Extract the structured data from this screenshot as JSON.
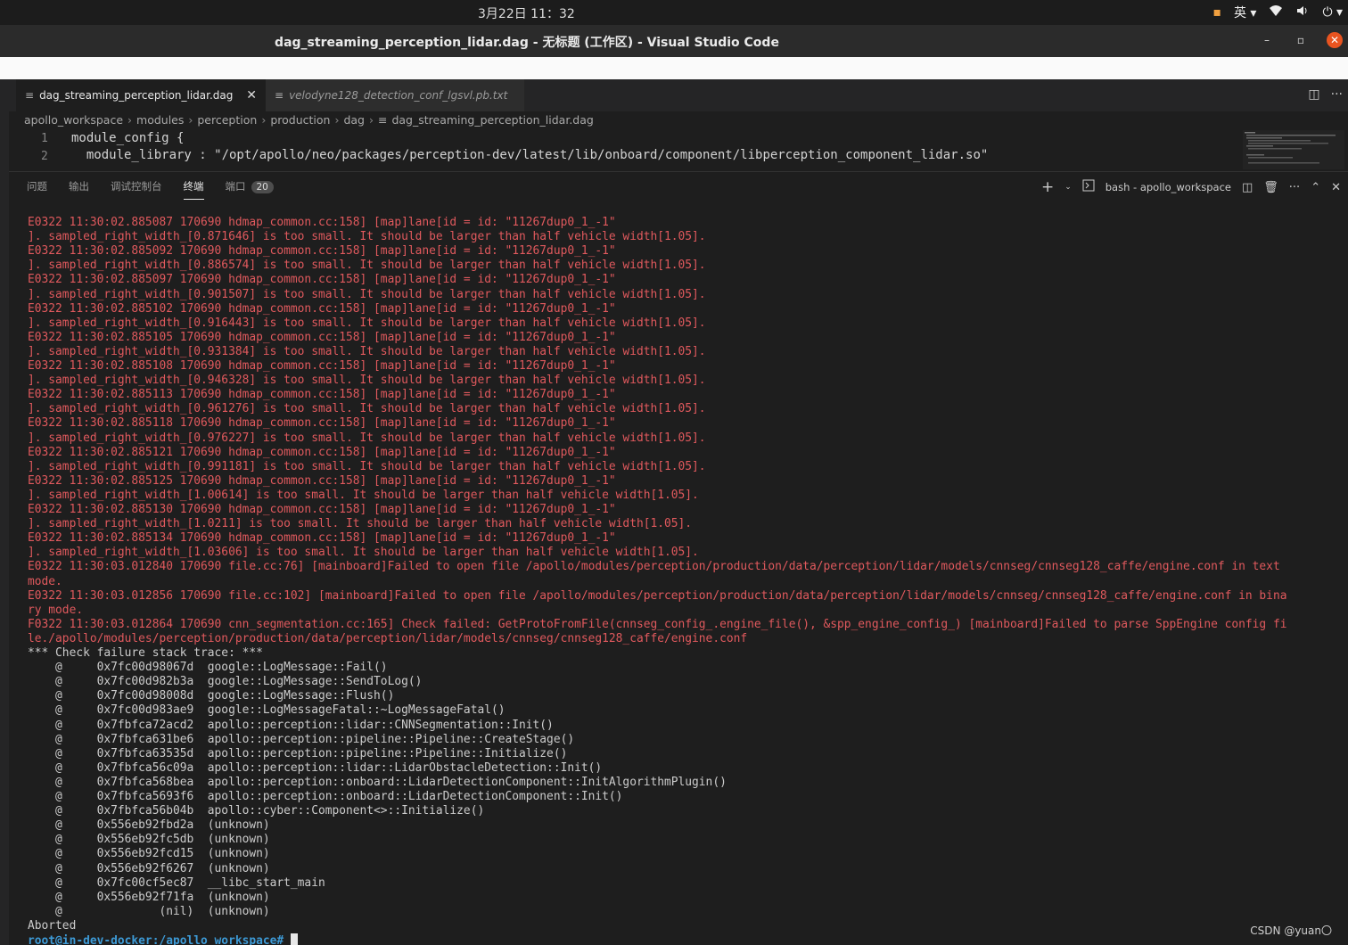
{
  "system_bar": {
    "clock": "3月22日  11：32",
    "input_method": "英 ▾"
  },
  "window": {
    "title": "dag_streaming_perception_lidar.dag - 无标题 (工作区) - Visual Studio Code"
  },
  "tabs": [
    {
      "label": "dag_streaming_perception_lidar.dag"
    },
    {
      "label": "velodyne128_detection_conf_lgsvl.pb.txt"
    }
  ],
  "breadcrumb": [
    "apollo_workspace",
    "modules",
    "perception",
    "production",
    "dag",
    "dag_streaming_perception_lidar.dag"
  ],
  "editor": {
    "lines": [
      {
        "num": "1",
        "text": "module_config {"
      },
      {
        "num": "2",
        "text": "  module_library : \"/opt/apollo/neo/packages/perception-dev/latest/lib/onboard/component/libperception_component_lidar.so\""
      }
    ]
  },
  "panel": {
    "tabs": [
      "问题",
      "输出",
      "调试控制台",
      "终端",
      "端口"
    ],
    "ports_badge": "20",
    "terminal_name": "bash - apollo_workspace"
  },
  "terminal": {
    "lines": [
      {
        "t": "E0322 11:30:02.885087 170690 hdmap_common.cc:158] [map]lane[id = id: \"11267dup0_1_-1\"",
        "s": "err"
      },
      {
        "t": "]. sampled_right_width_[0.871646] is too small. It should be larger than half vehicle width[1.05].",
        "s": "err"
      },
      {
        "t": "E0322 11:30:02.885092 170690 hdmap_common.cc:158] [map]lane[id = id: \"11267dup0_1_-1\"",
        "s": "err"
      },
      {
        "t": "]. sampled_right_width_[0.886574] is too small. It should be larger than half vehicle width[1.05].",
        "s": "err"
      },
      {
        "t": "E0322 11:30:02.885097 170690 hdmap_common.cc:158] [map]lane[id = id: \"11267dup0_1_-1\"",
        "s": "err"
      },
      {
        "t": "]. sampled_right_width_[0.901507] is too small. It should be larger than half vehicle width[1.05].",
        "s": "err"
      },
      {
        "t": "E0322 11:30:02.885102 170690 hdmap_common.cc:158] [map]lane[id = id: \"11267dup0_1_-1\"",
        "s": "err"
      },
      {
        "t": "]. sampled_right_width_[0.916443] is too small. It should be larger than half vehicle width[1.05].",
        "s": "err"
      },
      {
        "t": "E0322 11:30:02.885105 170690 hdmap_common.cc:158] [map]lane[id = id: \"11267dup0_1_-1\"",
        "s": "err"
      },
      {
        "t": "]. sampled_right_width_[0.931384] is too small. It should be larger than half vehicle width[1.05].",
        "s": "err"
      },
      {
        "t": "E0322 11:30:02.885108 170690 hdmap_common.cc:158] [map]lane[id = id: \"11267dup0_1_-1\"",
        "s": "err"
      },
      {
        "t": "]. sampled_right_width_[0.946328] is too small. It should be larger than half vehicle width[1.05].",
        "s": "err"
      },
      {
        "t": "E0322 11:30:02.885113 170690 hdmap_common.cc:158] [map]lane[id = id: \"11267dup0_1_-1\"",
        "s": "err"
      },
      {
        "t": "]. sampled_right_width_[0.961276] is too small. It should be larger than half vehicle width[1.05].",
        "s": "err"
      },
      {
        "t": "E0322 11:30:02.885118 170690 hdmap_common.cc:158] [map]lane[id = id: \"11267dup0_1_-1\"",
        "s": "err"
      },
      {
        "t": "]. sampled_right_width_[0.976227] is too small. It should be larger than half vehicle width[1.05].",
        "s": "err"
      },
      {
        "t": "E0322 11:30:02.885121 170690 hdmap_common.cc:158] [map]lane[id = id: \"11267dup0_1_-1\"",
        "s": "err"
      },
      {
        "t": "]. sampled_right_width_[0.991181] is too small. It should be larger than half vehicle width[1.05].",
        "s": "err"
      },
      {
        "t": "E0322 11:30:02.885125 170690 hdmap_common.cc:158] [map]lane[id = id: \"11267dup0_1_-1\"",
        "s": "err"
      },
      {
        "t": "]. sampled_right_width_[1.00614] is too small. It should be larger than half vehicle width[1.05].",
        "s": "err"
      },
      {
        "t": "E0322 11:30:02.885130 170690 hdmap_common.cc:158] [map]lane[id = id: \"11267dup0_1_-1\"",
        "s": "err"
      },
      {
        "t": "]. sampled_right_width_[1.0211] is too small. It should be larger than half vehicle width[1.05].",
        "s": "err"
      },
      {
        "t": "E0322 11:30:02.885134 170690 hdmap_common.cc:158] [map]lane[id = id: \"11267dup0_1_-1\"",
        "s": "err"
      },
      {
        "t": "]. sampled_right_width_[1.03606] is too small. It should be larger than half vehicle width[1.05].",
        "s": "err"
      },
      {
        "t": "E0322 11:30:03.012840 170690 file.cc:76] [mainboard]Failed to open file /apollo/modules/perception/production/data/perception/lidar/models/cnnseg/cnnseg128_caffe/engine.conf in text",
        "s": "err"
      },
      {
        "t": "mode.",
        "s": "err"
      },
      {
        "t": "E0322 11:30:03.012856 170690 file.cc:102] [mainboard]Failed to open file /apollo/modules/perception/production/data/perception/lidar/models/cnnseg/cnnseg128_caffe/engine.conf in bina",
        "s": "err"
      },
      {
        "t": "ry mode.",
        "s": "err"
      },
      {
        "t": "F0322 11:30:03.012864 170690 cnn_segmentation.cc:165] Check failed: GetProtoFromFile(cnnseg_config_.engine_file(), &spp_engine_config_) [mainboard]Failed to parse SppEngine config fi",
        "s": "err"
      },
      {
        "t": "le./apollo/modules/perception/production/data/perception/lidar/models/cnnseg/cnnseg128_caffe/engine.conf",
        "s": "err"
      },
      {
        "t": "*** Check failure stack trace: ***",
        "s": "norm"
      },
      {
        "t": "    @     0x7fc00d98067d  google::LogMessage::Fail()",
        "s": "norm"
      },
      {
        "t": "    @     0x7fc00d982b3a  google::LogMessage::SendToLog()",
        "s": "norm"
      },
      {
        "t": "    @     0x7fc00d98008d  google::LogMessage::Flush()",
        "s": "norm"
      },
      {
        "t": "    @     0x7fc00d983ae9  google::LogMessageFatal::~LogMessageFatal()",
        "s": "norm"
      },
      {
        "t": "    @     0x7fbfca72acd2  apollo::perception::lidar::CNNSegmentation::Init()",
        "s": "norm"
      },
      {
        "t": "    @     0x7fbfca631be6  apollo::perception::pipeline::Pipeline::CreateStage()",
        "s": "norm"
      },
      {
        "t": "    @     0x7fbfca63535d  apollo::perception::pipeline::Pipeline::Initialize()",
        "s": "norm"
      },
      {
        "t": "    @     0x7fbfca56c09a  apollo::perception::lidar::LidarObstacleDetection::Init()",
        "s": "norm"
      },
      {
        "t": "    @     0x7fbfca568bea  apollo::perception::onboard::LidarDetectionComponent::InitAlgorithmPlugin()",
        "s": "norm"
      },
      {
        "t": "    @     0x7fbfca5693f6  apollo::perception::onboard::LidarDetectionComponent::Init()",
        "s": "norm"
      },
      {
        "t": "    @     0x7fbfca56b04b  apollo::cyber::Component<>::Initialize()",
        "s": "norm"
      },
      {
        "t": "    @     0x556eb92fbd2a  (unknown)",
        "s": "norm"
      },
      {
        "t": "    @     0x556eb92fc5db  (unknown)",
        "s": "norm"
      },
      {
        "t": "    @     0x556eb92fcd15  (unknown)",
        "s": "norm"
      },
      {
        "t": "    @     0x556eb92f6267  (unknown)",
        "s": "norm"
      },
      {
        "t": "    @     0x7fc00cf5ec87  __libc_start_main",
        "s": "norm"
      },
      {
        "t": "    @     0x556eb92f71fa  (unknown)",
        "s": "norm"
      },
      {
        "t": "    @              (nil)  (unknown)",
        "s": "norm"
      },
      {
        "t": "Aborted",
        "s": "norm"
      }
    ],
    "prompt": "root@in-dev-docker:/apollo_workspace#"
  },
  "watermark": "CSDN @yuan〇"
}
